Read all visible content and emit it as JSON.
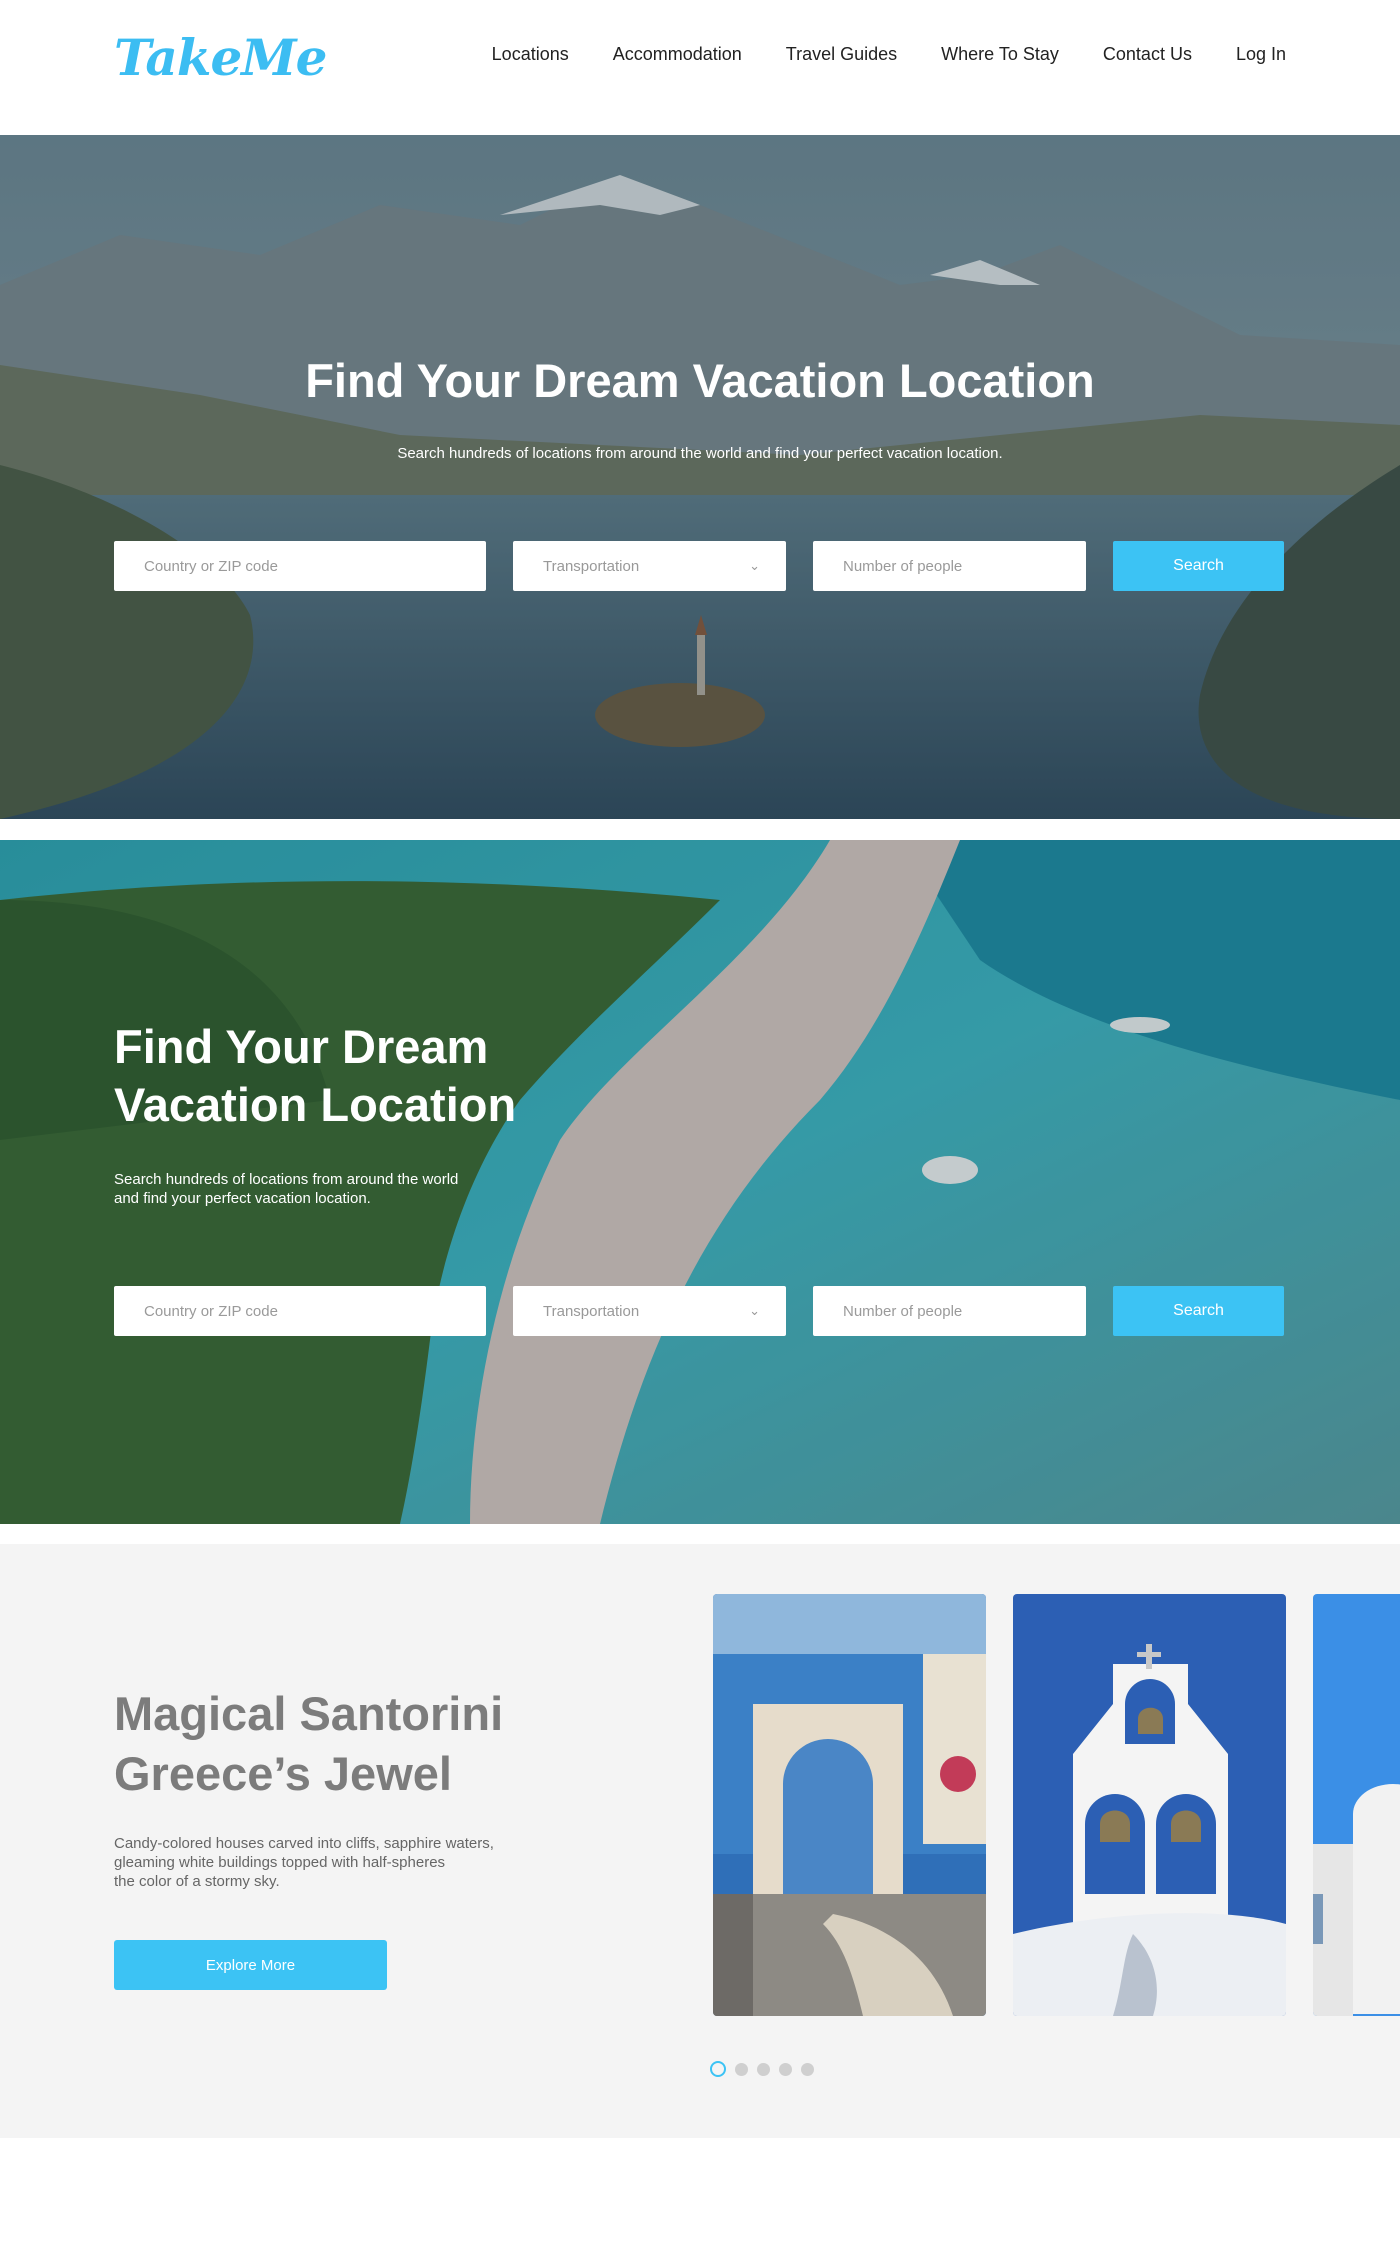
{
  "header": {
    "logo": "TakeMe",
    "nav": [
      "Locations",
      "Accommodation",
      "Travel Guides",
      "Where To Stay",
      "Contact Us",
      "Log In"
    ]
  },
  "hero1": {
    "title": "Find Your Dream Vacation Location",
    "subtitle": "Search hundreds of locations from around the world and find your perfect vacation location.",
    "search": {
      "location_placeholder": "Country or ZIP code",
      "transport_value": "Transportation",
      "people_placeholder": "Number of people",
      "button": "Search"
    }
  },
  "hero2": {
    "title_line1": "Find Your Dream",
    "title_line2": "Vacation Location",
    "subtitle_line1": "Search hundreds of locations from around the world",
    "subtitle_line2": "and find your perfect vacation location.",
    "search": {
      "location_placeholder": "Country or ZIP code",
      "transport_value": "Transportation",
      "people_placeholder": "Number of people",
      "button": "Search"
    }
  },
  "feature": {
    "title_line1": "Magical Santorini",
    "title_line2": "Greece’s Jewel",
    "desc_line1": "Candy-colored houses carved into cliffs, sapphire waters,",
    "desc_line2": "gleaming white buildings topped with half-spheres",
    "desc_line3": "the color of a stormy sky.",
    "button": "Explore More",
    "carousel_count": 5,
    "carousel_active": 1
  },
  "colors": {
    "accent": "#3cc3f4",
    "logo": "#3cbdf2",
    "feature_title": "#7c7c7c",
    "feature_bg": "#f4f4f4"
  }
}
